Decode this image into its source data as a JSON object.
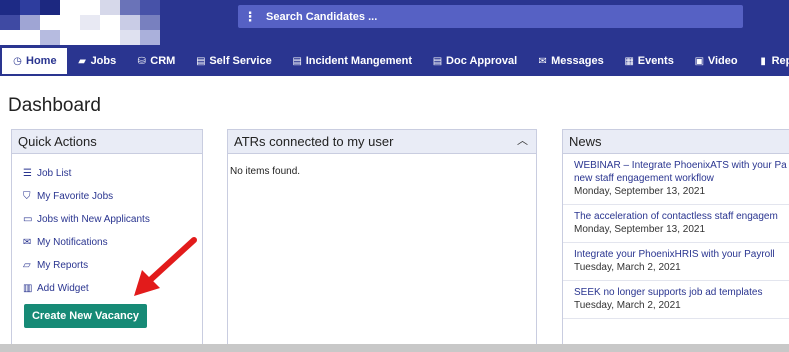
{
  "colors": {
    "brand": "#2a3590",
    "search_bg": "#5661c4",
    "accent_button": "#168a76",
    "arrow": "#e21b1b"
  },
  "logo": {
    "tiles": [
      "#1d2a85",
      "#2e3d9e",
      "#1c2880",
      "#ffffff",
      "#ffffff",
      "#d6d8ea",
      "#6a73b8",
      "#4752a8",
      "#3f4aa3",
      "#9fa5d4",
      "#ffffff",
      "#ffffff",
      "#e8e9f3",
      "#ffffff",
      "#c9cce6",
      "#7880bf",
      "#ffffff",
      "#ffffff",
      "#b6bbe0",
      "#ffffff",
      "#ffffff",
      "#ffffff",
      "#dfe1f0",
      "#aab0db"
    ]
  },
  "search": {
    "placeholder": "Search Candidates ...",
    "menu_icon": "⋮"
  },
  "nav": {
    "items": [
      {
        "label": "Home",
        "icon": "◷",
        "icon_name": "clock-icon"
      },
      {
        "label": "Jobs",
        "icon": "▰",
        "icon_name": "folder-icon"
      },
      {
        "label": "CRM",
        "icon": "⛁",
        "icon_name": "briefcase-icon"
      },
      {
        "label": "Self Service",
        "icon": "▤",
        "icon_name": "card-icon"
      },
      {
        "label": "Incident Mangement",
        "icon": "▤",
        "icon_name": "card-icon"
      },
      {
        "label": "Doc Approval",
        "icon": "▤",
        "icon_name": "card-icon"
      },
      {
        "label": "Messages",
        "icon": "✉",
        "icon_name": "envelope-icon"
      },
      {
        "label": "Events",
        "icon": "▦",
        "icon_name": "calendar-icon"
      },
      {
        "label": "Video",
        "icon": "▣",
        "icon_name": "video-icon"
      },
      {
        "label": "Reports",
        "icon": "▮",
        "icon_name": "report-icon"
      }
    ]
  },
  "page": {
    "title": "Dashboard"
  },
  "quick_actions": {
    "title": "Quick Actions",
    "items": [
      {
        "label": "Job List",
        "icon": "☰"
      },
      {
        "label": "My Favorite Jobs",
        "icon": "⛉"
      },
      {
        "label": "Jobs with New Applicants",
        "icon": "▭"
      },
      {
        "label": "My Notifications",
        "icon": "✉"
      },
      {
        "label": "My Reports",
        "icon": "▱"
      },
      {
        "label": "Add Widget",
        "icon": "▥"
      }
    ],
    "button_label": "Create New Vacancy"
  },
  "atr": {
    "title": "ATRs connected to my user",
    "collapse_icon": "︿",
    "empty": "No items found."
  },
  "news": {
    "title": "News",
    "items": [
      {
        "title": "WEBINAR – Integrate PhoenixATS with your Pa",
        "title2": "new staff engagement workflow",
        "date": "Monday, September 13, 2021"
      },
      {
        "title": "The acceleration of contactless staff engagem",
        "date": "Monday, September 13, 2021"
      },
      {
        "title": "Integrate your PhoenixHRIS with your Payroll",
        "date": "Tuesday, March 2, 2021"
      },
      {
        "title": "SEEK no longer supports job ad templates",
        "date": "Tuesday, March 2, 2021"
      }
    ]
  }
}
